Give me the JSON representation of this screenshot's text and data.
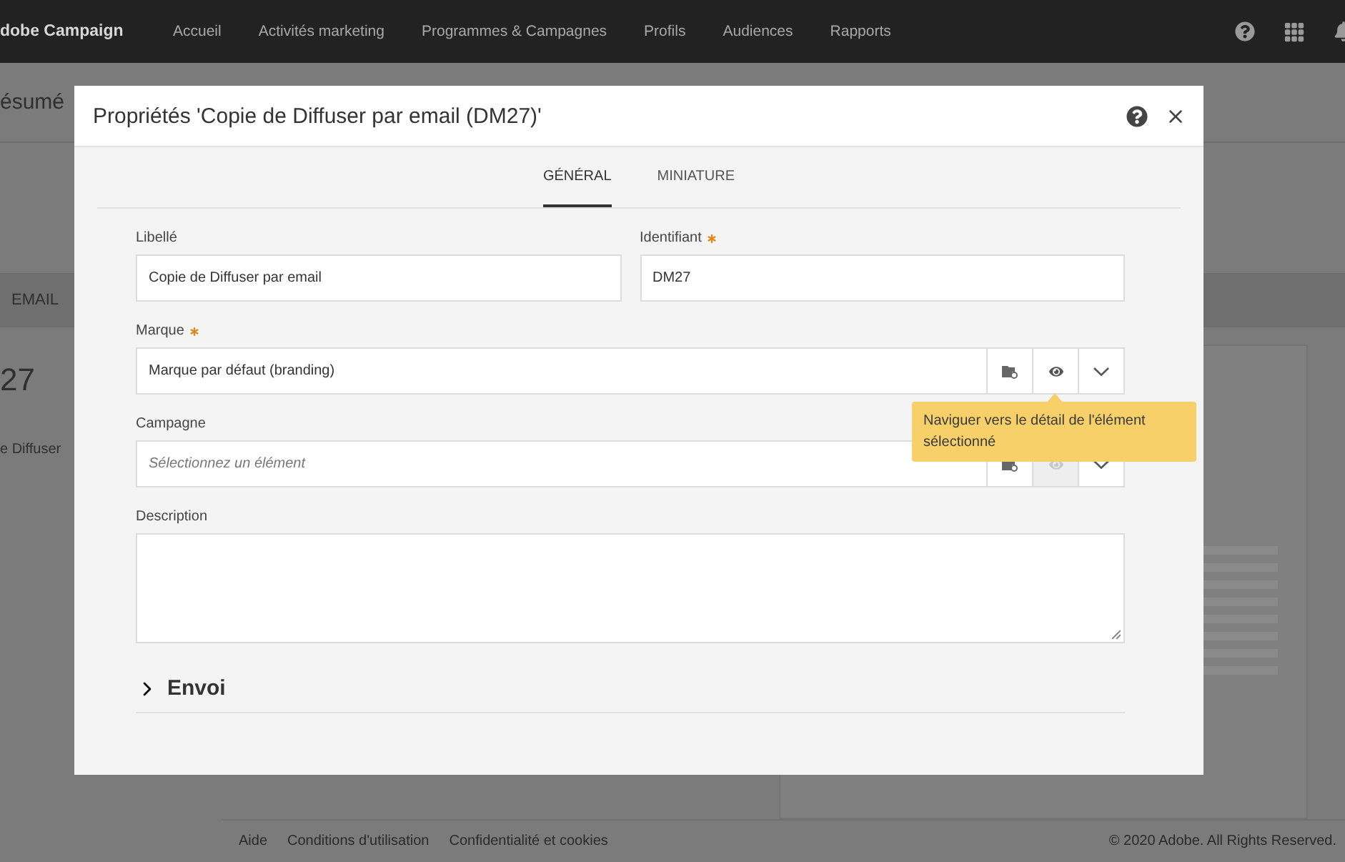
{
  "topbar": {
    "brand": "dobe Campaign",
    "nav": [
      "Accueil",
      "Activités marketing",
      "Programmes & Campagnes",
      "Profils",
      "Audiences",
      "Rapports"
    ]
  },
  "page": {
    "title": "ésumé",
    "tab": "EMAIL",
    "number": "27",
    "label": "e Diffuser"
  },
  "footer": {
    "links": [
      "Aide",
      "Conditions d'utilisation",
      "Confidentialité et cookies"
    ],
    "copyright": "© 2020 Adobe. All Rights Reserved."
  },
  "dialog": {
    "title": "Propriétés 'Copie de Diffuser par email (DM27)'",
    "tabs": [
      {
        "label": "GÉNÉRAL",
        "selected": true
      },
      {
        "label": "MINIATURE",
        "selected": false
      }
    ],
    "fields": [
      {
        "kind": "text",
        "label": "Libellé",
        "required": false,
        "value": "Copie de Diffuser par email"
      },
      {
        "kind": "text",
        "label": "Identifiant",
        "required": true,
        "value": "DM27"
      },
      {
        "kind": "link",
        "label": "Marque",
        "required": true,
        "value": "Marque par défaut (branding)",
        "actions": [
          {
            "kind": "folder",
            "disabled": false
          },
          {
            "kind": "view",
            "disabled": false
          },
          {
            "kind": "dropdown",
            "disabled": false
          }
        ]
      },
      {
        "kind": "link",
        "label": "Campagne",
        "required": false,
        "placeholder": "Sélectionnez un élément",
        "actions": [
          {
            "kind": "folder",
            "disabled": false
          },
          {
            "kind": "view",
            "disabled": true
          },
          {
            "kind": "dropdown",
            "disabled": false
          }
        ]
      },
      {
        "kind": "textarea",
        "label": "Description",
        "required": false
      }
    ],
    "section": {
      "label": "Envoi",
      "expanded": false
    },
    "tooltip": "Naviguer vers le détail de l'élément sélectionné"
  }
}
